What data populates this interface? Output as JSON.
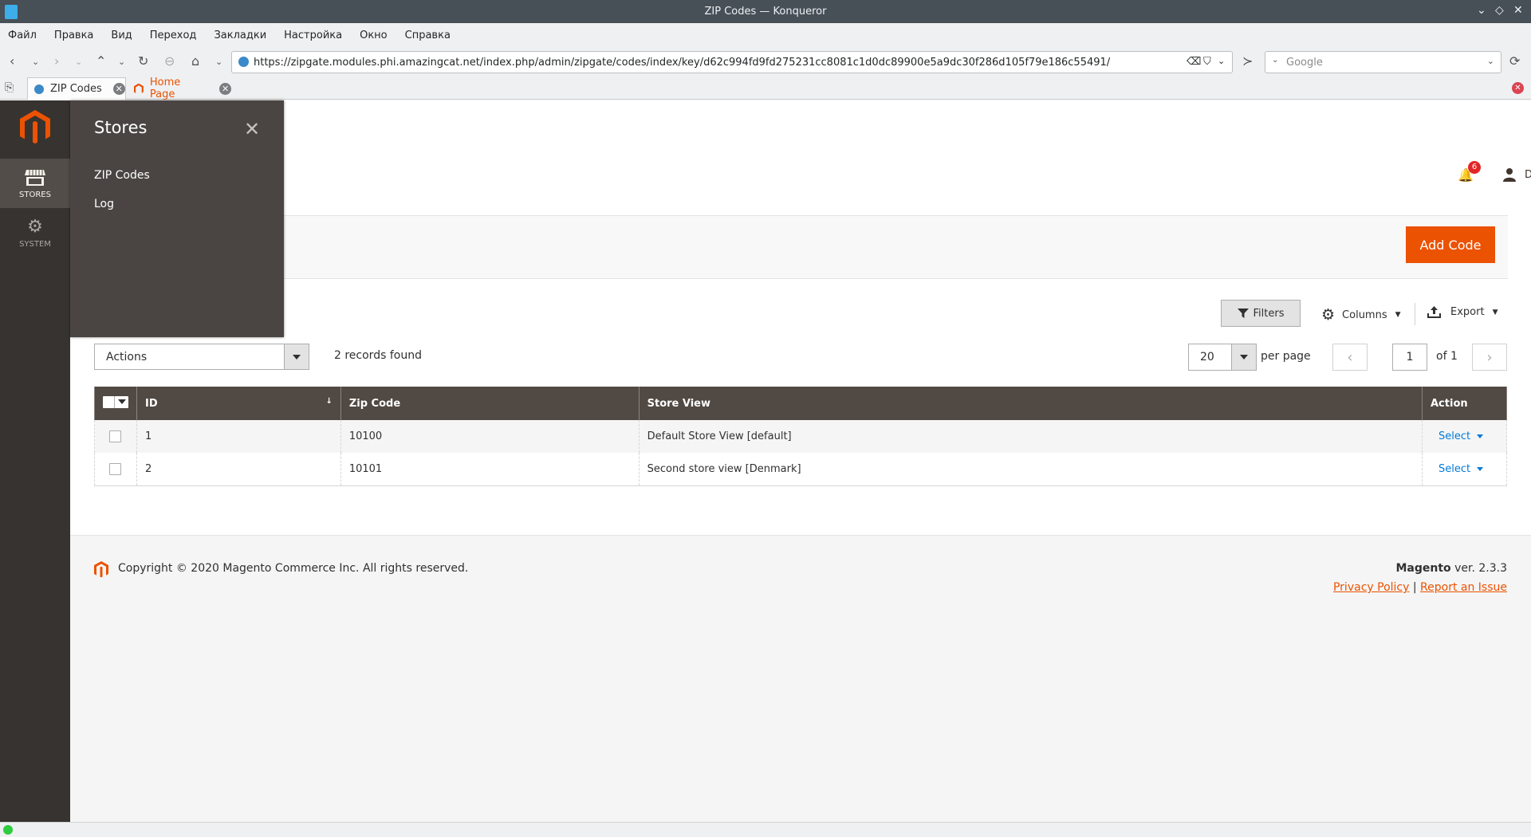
{
  "window": {
    "title": "ZIP Codes — Konqueror"
  },
  "menubar": [
    "Файл",
    "Правка",
    "Вид",
    "Переход",
    "Закладки",
    "Настройка",
    "Окно",
    "Справка"
  ],
  "browser": {
    "url": "https://zipgate.modules.phi.amazingcat.net/index.php/admin/zipgate/codes/index/key/d62c994fd9fd275231cc8081c1d0dc89900e5a9dc30f286d105f79e186c55491/",
    "search_placeholder": "Google",
    "tabs": [
      {
        "label": "ZIP Codes",
        "active": true
      },
      {
        "label": "Home Page",
        "active": false
      }
    ]
  },
  "sidebar": {
    "items": [
      {
        "label": "STORES",
        "icon": "store-icon",
        "active": true
      },
      {
        "label": "SYSTEM",
        "icon": "gear-icon",
        "active": false
      }
    ]
  },
  "submenu": {
    "title": "Stores",
    "items": [
      "ZIP Codes",
      "Log"
    ]
  },
  "header": {
    "notification_count": "6",
    "user_name": "Demo"
  },
  "page_actions": {
    "add_label": "Add Code"
  },
  "grid_toolbar": {
    "filters_label": "Filters",
    "columns_label": "Columns",
    "export_label": "Export",
    "actions_label": "Actions",
    "records_found": "2 records found",
    "per_page_value": "20",
    "per_page_label": "per page",
    "current_page": "1",
    "pages_total": "of 1"
  },
  "table": {
    "headers": [
      "ID",
      "Zip Code",
      "Store View",
      "Action"
    ],
    "rows": [
      {
        "id": "1",
        "zip": "10100",
        "store_view": "Default Store View [default]",
        "action": "Select"
      },
      {
        "id": "2",
        "zip": "10101",
        "store_view": "Second store view [Denmark]",
        "action": "Select"
      }
    ]
  },
  "footer": {
    "copyright": "Copyright © 2020 Magento Commerce Inc. All rights reserved.",
    "brand": "Magento",
    "version": "ver. 2.3.3",
    "privacy_link": "Privacy Policy",
    "separator": "|",
    "report_link": "Report an Issue"
  },
  "colors": {
    "accent": "#eb5202",
    "sidebar_bg": "#373330",
    "table_header_bg": "#514943",
    "link": "#007bdb"
  }
}
